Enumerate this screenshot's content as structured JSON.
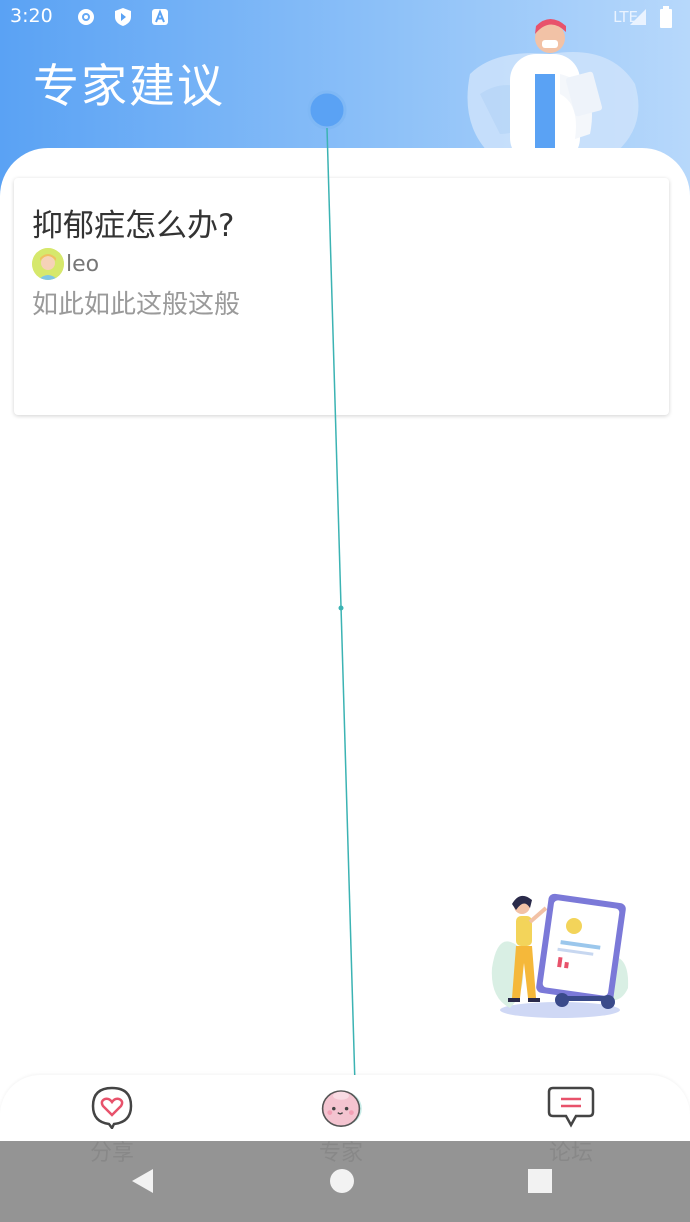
{
  "status_bar": {
    "time": "3:20",
    "network": "LTE",
    "icons": [
      "gear-icon",
      "play-protect-icon",
      "a-icon",
      "signal-icon",
      "battery-icon"
    ]
  },
  "header": {
    "title": "专家建议"
  },
  "posts": [
    {
      "title": "抑郁症怎么办?",
      "author": "leo",
      "excerpt": "如此如此这般这般"
    }
  ],
  "tabs": [
    {
      "label": "分享",
      "icon": "heart-bubble-icon"
    },
    {
      "label": "专家",
      "icon": "expert-face-icon"
    },
    {
      "label": "论坛",
      "icon": "chat-bubble-icon"
    }
  ],
  "navigation": {
    "icons": [
      "back-icon",
      "home-icon",
      "recents-icon"
    ]
  },
  "colors": {
    "header_start": "#5aa2f4",
    "header_end": "#b7d8fb",
    "accent_teal": "#3bb3b3",
    "tab_accent": "#e8526b"
  }
}
